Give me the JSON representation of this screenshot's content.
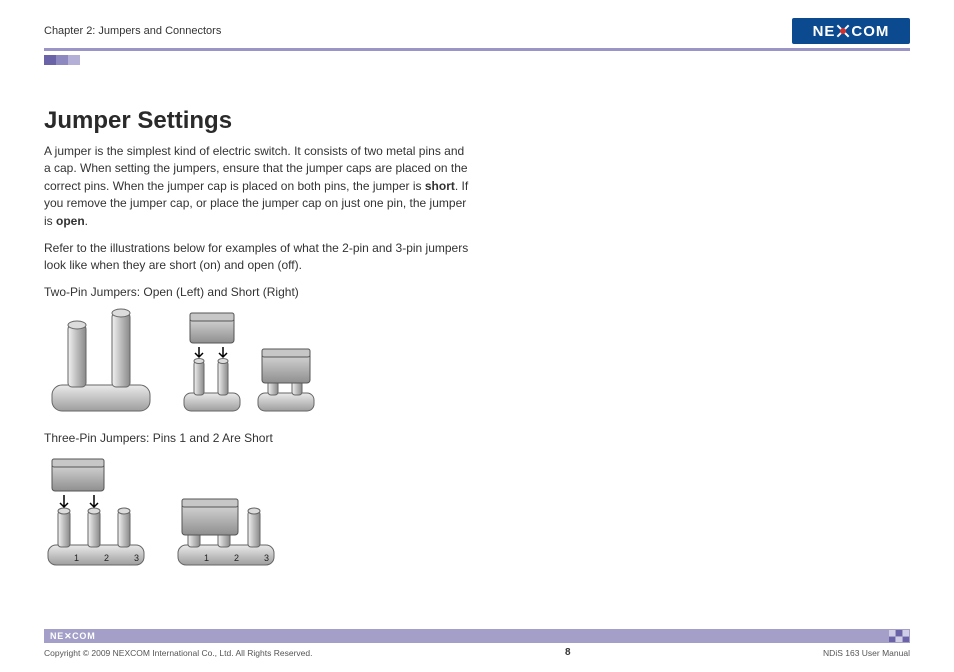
{
  "header": {
    "chapter": "Chapter 2: Jumpers and Connectors",
    "logo_text_left": "NE",
    "logo_text_right": "COM"
  },
  "title": "Jumper Settings",
  "para1_a": "A jumper is the simplest kind of electric switch. It consists of two metal pins and a cap. When setting the jumpers, ensure that the jumper caps are placed on the correct pins. When the jumper cap is placed on both pins, the jumper is ",
  "para1_b": "short",
  "para1_c": ". If you remove the jumper cap, or place the jumper cap on just one pin, the jumper is ",
  "para1_d": "open",
  "para1_e": ".",
  "para2": "Refer to the illustrations below for examples of what the 2-pin and 3-pin jumpers look like when they are short (on) and open (off).",
  "caption1": "Two-Pin Jumpers: Open (Left) and Short (Right)",
  "caption2": "Three-Pin Jumpers: Pins 1 and 2 Are Short",
  "pin_labels": {
    "p1": "1",
    "p2": "2",
    "p3": "3"
  },
  "footer": {
    "logo": "NE COM",
    "copyright": "Copyright © 2009 NEXCOM International Co., Ltd. All Rights Reserved.",
    "page": "8",
    "manual": "NDiS 163 User Manual"
  }
}
